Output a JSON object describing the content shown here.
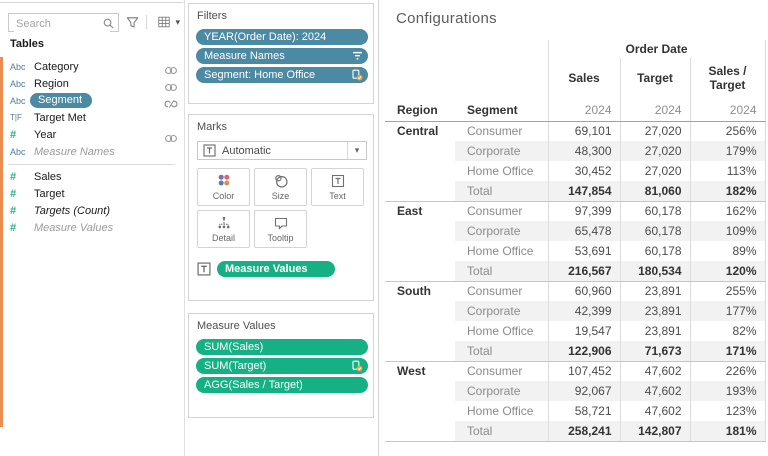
{
  "colors": {
    "pill_blue": "#4c89a3",
    "pill_green": "#15b185",
    "accent_orange": "#ea8d4f"
  },
  "data_pane": {
    "search_placeholder": "Search",
    "tables_header": "Tables",
    "fields": [
      {
        "type_icon": "Abc",
        "label": "Category",
        "right_icon": "link-icon"
      },
      {
        "type_icon": "Abc",
        "label": "Region",
        "right_icon": "link-icon"
      },
      {
        "type_icon": "Abc",
        "label": "Segment",
        "selected": true,
        "right_icon": "broken-link-icon"
      },
      {
        "type_icon": "T|F",
        "label": "Target Met"
      },
      {
        "type_icon": "#",
        "label": "Year",
        "right_icon": "link-icon"
      },
      {
        "type_icon": "Abc",
        "label": "Measure Names",
        "style": "italic-grey"
      },
      {
        "type_icon": "#",
        "label": "Sales",
        "section": "measures"
      },
      {
        "type_icon": "#",
        "label": "Target",
        "section": "measures"
      },
      {
        "type_icon": "#",
        "label": "Targets (Count)",
        "style": "italic",
        "section": "measures"
      },
      {
        "type_icon": "#",
        "label": "Measure Values",
        "style": "italic-grey",
        "section": "measures"
      }
    ]
  },
  "filters_shelf": {
    "title": "Filters",
    "pills": [
      {
        "label": "YEAR(Order Date): 2024"
      },
      {
        "label": "Measure Names",
        "right_icon": "filter-lines-icon"
      },
      {
        "label": "Segment: Home Office",
        "right_icon": "datasource-check-icon"
      }
    ]
  },
  "marks_card": {
    "title": "Marks",
    "mark_type": "Automatic",
    "buttons": [
      {
        "icon": "color-icon",
        "label": "Color"
      },
      {
        "icon": "size-icon",
        "label": "Size"
      },
      {
        "icon": "text-icon",
        "label": "Text"
      },
      {
        "icon": "detail-icon",
        "label": "Detail"
      },
      {
        "icon": "tooltip-icon",
        "label": "Tooltip"
      }
    ],
    "text_encoding_pill": "Measure Values"
  },
  "measure_values_shelf": {
    "title": "Measure Values",
    "pills": [
      {
        "label": "SUM(Sales)"
      },
      {
        "label": "SUM(Target)",
        "right_icon": "datasource-check-icon"
      },
      {
        "label": "AGG(Sales / Target)"
      }
    ]
  },
  "sheet": {
    "title": "Configurations",
    "column_dimension": "Order Date",
    "year_label": "2024",
    "measure_headers": [
      "Sales",
      "Target",
      "Sales / Target"
    ],
    "row_headers": [
      "Region",
      "Segment"
    ],
    "chart_data": {
      "type": "table",
      "regions": [
        {
          "region": "Central",
          "rows": [
            {
              "segment": "Consumer",
              "sales": "69,101",
              "target": "27,020",
              "sales_over_target": "256%"
            },
            {
              "segment": "Corporate",
              "sales": "48,300",
              "target": "27,020",
              "sales_over_target": "179%"
            },
            {
              "segment": "Home Office",
              "sales": "30,452",
              "target": "27,020",
              "sales_over_target": "113%"
            },
            {
              "segment": "Total",
              "sales": "147,854",
              "target": "81,060",
              "sales_over_target": "182%",
              "is_total": true
            }
          ]
        },
        {
          "region": "East",
          "rows": [
            {
              "segment": "Consumer",
              "sales": "97,399",
              "target": "60,178",
              "sales_over_target": "162%"
            },
            {
              "segment": "Corporate",
              "sales": "65,478",
              "target": "60,178",
              "sales_over_target": "109%"
            },
            {
              "segment": "Home Office",
              "sales": "53,691",
              "target": "60,178",
              "sales_over_target": "89%"
            },
            {
              "segment": "Total",
              "sales": "216,567",
              "target": "180,534",
              "sales_over_target": "120%",
              "is_total": true
            }
          ]
        },
        {
          "region": "South",
          "rows": [
            {
              "segment": "Consumer",
              "sales": "60,960",
              "target": "23,891",
              "sales_over_target": "255%"
            },
            {
              "segment": "Corporate",
              "sales": "42,399",
              "target": "23,891",
              "sales_over_target": "177%"
            },
            {
              "segment": "Home Office",
              "sales": "19,547",
              "target": "23,891",
              "sales_over_target": "82%"
            },
            {
              "segment": "Total",
              "sales": "122,906",
              "target": "71,673",
              "sales_over_target": "171%",
              "is_total": true
            }
          ]
        },
        {
          "region": "West",
          "rows": [
            {
              "segment": "Consumer",
              "sales": "107,452",
              "target": "47,602",
              "sales_over_target": "226%"
            },
            {
              "segment": "Corporate",
              "sales": "92,067",
              "target": "47,602",
              "sales_over_target": "193%"
            },
            {
              "segment": "Home Office",
              "sales": "58,721",
              "target": "47,602",
              "sales_over_target": "123%"
            },
            {
              "segment": "Total",
              "sales": "258,241",
              "target": "142,807",
              "sales_over_target": "181%",
              "is_total": true
            }
          ]
        }
      ]
    }
  }
}
